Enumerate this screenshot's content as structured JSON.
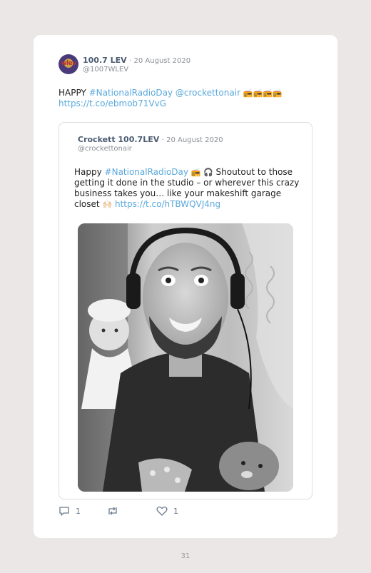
{
  "tweet": {
    "author_name": "100.7 LEV",
    "date": "· 20 August 2020",
    "handle": "@1007WLEV",
    "text_prefix": "HAPPY ",
    "hashtag": "#NationalRadioDay",
    "mention": "@crockettonair",
    "emojis": "📻📻📻📻",
    "link": "https://t.co/ebmob71VvG",
    "avatar_logo_text": "wlev"
  },
  "quoted": {
    "author_name": "Crockett 100.7LEV",
    "date": "· 20 August 2020",
    "handle": "@crockettonair",
    "text_prefix": "Happy ",
    "hashtag": "#NationalRadioDay",
    "emojis_mid": "📻 🎧",
    "text_body": " Shoutout to those getting it done in the studio –  or wherever this crazy business takes you… like your makeshift garage closet ",
    "emoji_end": "🙌🏻",
    "link": "https://t.co/hTBWQVJ4ng"
  },
  "actions": {
    "reply_count": "1",
    "like_count": "1"
  },
  "page_number": "31"
}
